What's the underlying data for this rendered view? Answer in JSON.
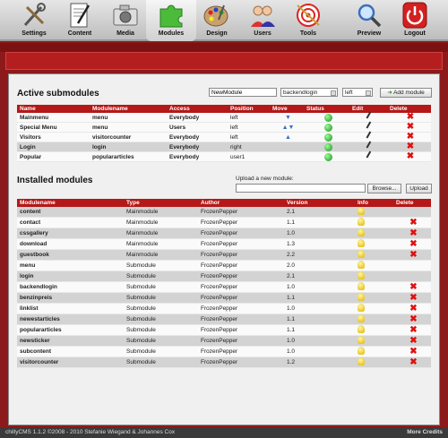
{
  "nav": [
    {
      "label": "Settings",
      "icon": "tools-icon"
    },
    {
      "label": "Content",
      "icon": "document-pen-icon"
    },
    {
      "label": "Media",
      "icon": "camera-icon"
    },
    {
      "label": "Modules",
      "icon": "puzzle-icon"
    },
    {
      "label": "Design",
      "icon": "palette-icon"
    },
    {
      "label": "Users",
      "icon": "users-icon"
    },
    {
      "label": "Tools",
      "icon": "target-icon"
    },
    {
      "label": "Preview",
      "icon": "magnifier-icon"
    },
    {
      "label": "Logout",
      "icon": "power-icon"
    }
  ],
  "active": {
    "title": "Active submodules",
    "new_module_value": "NewModule",
    "area_select": "backendlogin",
    "position_select": "left",
    "add_label": "Add module",
    "headers": [
      "Name",
      "Modulename",
      "Access",
      "Position",
      "Move",
      "Status",
      "Edit",
      "Delete"
    ],
    "rows": [
      {
        "name": "Mainmenu",
        "module": "menu",
        "access": "Everybody",
        "position": "left"
      },
      {
        "name": "Special Menu",
        "module": "menu",
        "access": "Users",
        "position": "left"
      },
      {
        "name": "Visitors",
        "module": "visitorcounter",
        "access": "Everybody",
        "position": "left"
      },
      {
        "name": "Login",
        "module": "login",
        "access": "Everybody",
        "position": "right"
      },
      {
        "name": "Popular",
        "module": "populararticles",
        "access": "Everybody",
        "position": "user1"
      }
    ]
  },
  "installed": {
    "title": "Installed modules",
    "upload_label": "Upload a new module:",
    "browse_label": "Browse...",
    "upload_button": "Upload",
    "headers": [
      "Modulename",
      "Type",
      "Author",
      "Version",
      "Info",
      "Delete"
    ],
    "rows": [
      {
        "name": "content",
        "type": "Mainmodule",
        "author": "FrozenPepper",
        "version": "2.1"
      },
      {
        "name": "contact",
        "type": "Mainmodule",
        "author": "FrozenPepper",
        "version": "1.1"
      },
      {
        "name": "cssgallery",
        "type": "Mainmodule",
        "author": "FrozenPepper",
        "version": "1.0"
      },
      {
        "name": "download",
        "type": "Mainmodule",
        "author": "FrozenPepper",
        "version": "1.3"
      },
      {
        "name": "guestbook",
        "type": "Mainmodule",
        "author": "FrozenPepper",
        "version": "2.2"
      },
      {
        "name": "menu",
        "type": "Submodule",
        "author": "FrozenPepper",
        "version": "2.0"
      },
      {
        "name": "login",
        "type": "Submodule",
        "author": "FrozenPepper",
        "version": "2.1"
      },
      {
        "name": "backendlogin",
        "type": "Submodule",
        "author": "FrozenPepper",
        "version": "1.0"
      },
      {
        "name": "benzinpreis",
        "type": "Submodule",
        "author": "FrozenPepper",
        "version": "1.1"
      },
      {
        "name": "linklist",
        "type": "Submodule",
        "author": "FrozenPepper",
        "version": "1.0"
      },
      {
        "name": "newestarticles",
        "type": "Submodule",
        "author": "FrozenPepper",
        "version": "1.1"
      },
      {
        "name": "populararticles",
        "type": "Submodule",
        "author": "FrozenPepper",
        "version": "1.1"
      },
      {
        "name": "newsticker",
        "type": "Submodule",
        "author": "FrozenPepper",
        "version": "1.0"
      },
      {
        "name": "subcontent",
        "type": "Submodule",
        "author": "FrozenPepper",
        "version": "1.0"
      },
      {
        "name": "visitorcounter",
        "type": "Submodule",
        "author": "FrozenPepper",
        "version": "1.2"
      }
    ]
  },
  "footer": {
    "copyright": "chillyCMS 1.1.2 ©2008 - 2010 Stefanie Wiegand & Johannes Cox",
    "credits": "More Credits"
  }
}
